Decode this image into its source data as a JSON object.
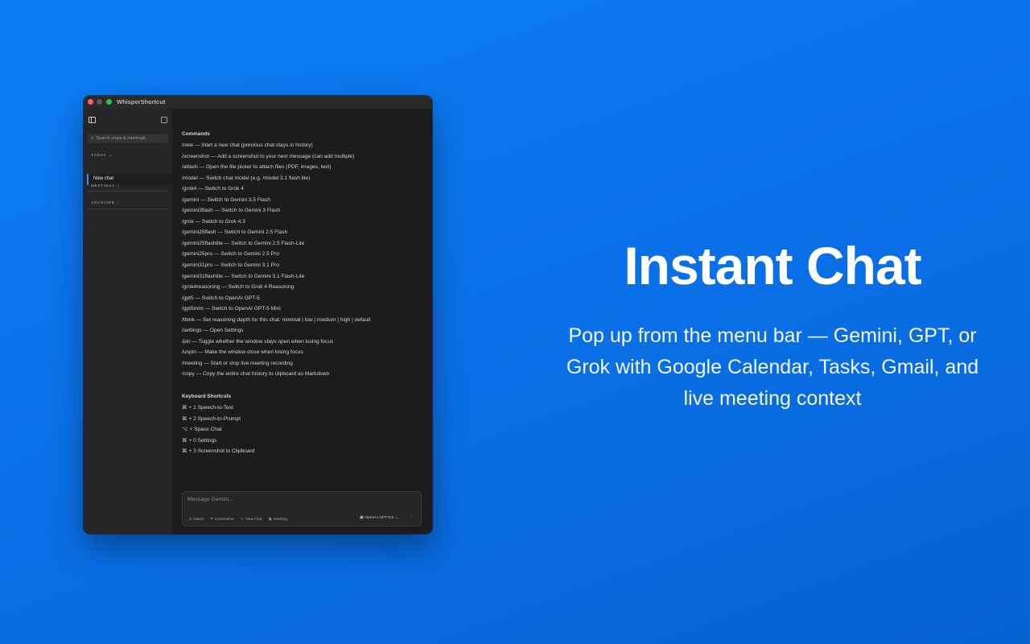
{
  "app": {
    "window_title": "WhisperShortcut"
  },
  "sidebar": {
    "search_placeholder": "Search chats & meetings",
    "sections": {
      "today": "TODAY",
      "meetings": "MEETINGS",
      "archived": "ARCHIVED"
    },
    "selected_chat": "New chat"
  },
  "main": {
    "commands_heading": "Commands",
    "commands": [
      "/new — Start a new chat (previous chat stays in history)",
      "/screenshot — Add a screenshot to your next message (can add multiple)",
      "/attach — Open the file picker to attach files (PDF, images, text)",
      "/model — Switch chat model (e.g. /model 3.1 flash lite)",
      "/grok4 — Switch to Grok 4",
      "/gemini — Switch to Gemini 3.5 Flash",
      "/gemini3flash — Switch to Gemini 3 Flash",
      "/grok — Switch to Grok 4.3",
      "/gemini25flash — Switch to Gemini 2.5 Flash",
      "/gemini25flashlite — Switch to Gemini 2.5 Flash-Lite",
      "/gemini25pro — Switch to Gemini 2.5 Pro",
      "/gemini31pro — Switch to Gemini 3.1 Pro",
      "/gemini31flashlite — Switch to Gemini 3.1 Flash-Lite",
      "/grok4reasoning — Switch to Grok 4 Reasoning",
      "/gpt5 — Switch to OpenAI GPT-5",
      "/gpt5mini — Switch to OpenAI GPT-5 Mini",
      "/think — Set reasoning depth for this chat: minimal | low | medium | high | default",
      "/settings — Open Settings",
      "/pin — Toggle whether the window stays open when losing focus",
      "/unpin — Make the window close when losing focus",
      "/meeting — Start or stop live meeting recording",
      "/copy — Copy the entire chat history to clipboard as Markdown"
    ],
    "shortcuts_heading": "Keyboard Shortcuts",
    "shortcuts": [
      "⌘ + 1  Speech-to-Text",
      "⌘ + 2  Speech-to-Prompt",
      "⌥ + Space  Chat",
      "⌘ + 0  Settings",
      "⌘ + 3  Screenshot to Clipboard"
    ]
  },
  "composer": {
    "placeholder": "Message Gemini...",
    "attach": "Attach",
    "screenshot": "Screenshot",
    "new_chat": "New chat",
    "meeting": "Meeting",
    "model": "OpenAI GPT-5.5"
  },
  "hero": {
    "title": "Instant Chat",
    "subtitle": "Pop up from the menu bar — Gemini, GPT, or Grok with Google Calendar, Tasks, Gmail, and live meeting context"
  },
  "colors": {
    "background": "#0b72ea",
    "accent": "#3a8dff",
    "window": "#1c1c1e"
  }
}
